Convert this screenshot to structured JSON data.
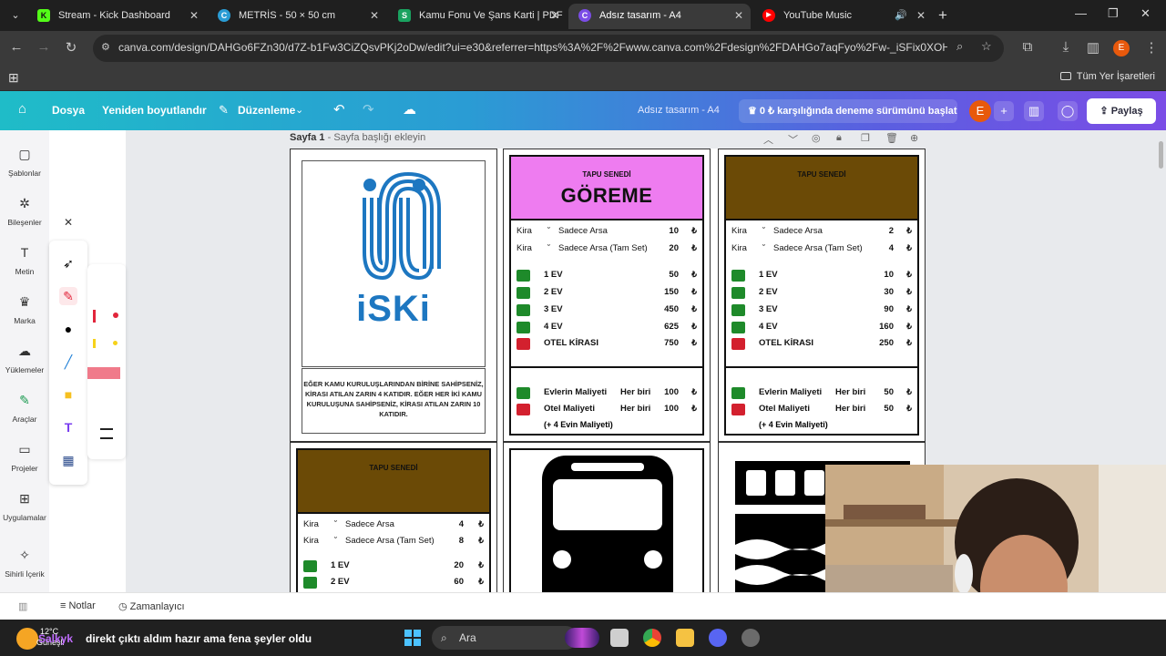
{
  "browser": {
    "tabs": [
      {
        "title": "Stream - Kick Dashboard",
        "icon": "kick-icon",
        "color": "#53fc18",
        "glyph": "K"
      },
      {
        "title": "METRİS - 50 × 50 cm",
        "icon": "canva-icon",
        "color": "#2a9cd4",
        "glyph": "C"
      },
      {
        "title": "Kamu Fonu Ve Şans Karti | PDF",
        "icon": "scribd-icon",
        "color": "#1aa260",
        "glyph": "S"
      },
      {
        "title": "Adsız tasarım - A4",
        "icon": "canva-icon",
        "color": "#7b4de6",
        "glyph": "C",
        "active": true
      },
      {
        "title": "YouTube Music",
        "icon": "youtube-music-icon",
        "color": "#ff0000",
        "glyph": "▶"
      }
    ],
    "url": "canva.com/design/DAHGo6FZn30/d7Z-b1Fw3CiZQsvPKj2oDw/edit?ui=e30&referrer=https%3A%2F%2Fwww.canva.com%2Fdesign%2FDAHGo7aqFyo%2Fw-_iSFix0XOHZaX8vt...",
    "profile_initial": "E",
    "bookmarks_all": "Tüm Yer İşaretleri"
  },
  "canva": {
    "home": "home-icon",
    "menu": [
      "Dosya",
      "Yeniden boyutlandır",
      "Düzenleme"
    ],
    "design_title": "Adsız tasarım - A4",
    "trial": "0 ₺ karşılığında deneme sürümünü başlat",
    "avatar": "E",
    "share": "Paylaş",
    "rail": [
      {
        "label": "Şablonlar",
        "icon": "templates-icon",
        "glyph": "▢"
      },
      {
        "label": "Bileşenler",
        "icon": "elements-icon",
        "glyph": "✲"
      },
      {
        "label": "Metin",
        "icon": "text-icon",
        "glyph": "T"
      },
      {
        "label": "Marka",
        "icon": "brand-icon",
        "glyph": "♛"
      },
      {
        "label": "Yüklemeler",
        "icon": "uploads-icon",
        "glyph": "☁"
      },
      {
        "label": "Araçlar",
        "icon": "draw-tools-icon",
        "glyph": "✎"
      },
      {
        "label": "Projeler",
        "icon": "folder-icon",
        "glyph": "▭"
      },
      {
        "label": "Uygulamalar",
        "icon": "apps-icon",
        "glyph": "⊞"
      },
      {
        "label": "Sihirli İçerik",
        "icon": "magic-media-icon",
        "glyph": "✧"
      }
    ],
    "page_label": "Sayfa 1",
    "page_title_placeholder": "Sayfa başlığı ekleyin",
    "notes": "Notlar",
    "timer": "Zamanlayıcı"
  },
  "cards": {
    "iski": {
      "logo_text": "iSKi",
      "note": "EĞER KAMU KURULUŞLARINDAN BİRİNE SAHİPSENİZ, KİRASI ATILAN ZARIN 4 KATIDIR. EĞER HER İKİ KAMU KURULUŞUNA SAHİPSENİZ, KİRASI ATILAN ZARIN 10 KATIDIR."
    },
    "goreme": {
      "header_label": "TAPU SENEDİ",
      "name": "GÖREME",
      "color": "#ee7cf0",
      "rent_label": "Kira",
      "land": "Sadece Arsa",
      "land_set": "Sadece Arsa (Tam Set)",
      "land_value": "10",
      "land_set_value": "20",
      "houses": [
        {
          "label": "1 EV",
          "value": "50"
        },
        {
          "label": "2 EV",
          "value": "150"
        },
        {
          "label": "3 EV",
          "value": "450"
        },
        {
          "label": "4 EV",
          "value": "625"
        }
      ],
      "hotel_label": "OTEL KİRASI",
      "hotel_value": "750",
      "house_cost_label": "Evlerin Maliyeti",
      "hotel_cost_label": "Otel Maliyeti",
      "each": "Her biri",
      "house_cost": "100",
      "hotel_cost": "100",
      "hotel_note": "(+ 4 Evin Maliyeti)",
      "currency": "₺"
    },
    "brown1": {
      "header_label": "TAPU SENEDİ",
      "color": "#6b4a06",
      "rent_label": "Kira",
      "land": "Sadece Arsa",
      "land_set": "Sadece Arsa (Tam Set)",
      "land_value": "2",
      "land_set_value": "4",
      "houses": [
        {
          "label": "1 EV",
          "value": "10"
        },
        {
          "label": "2 EV",
          "value": "30"
        },
        {
          "label": "3 EV",
          "value": "90"
        },
        {
          "label": "4 EV",
          "value": "160"
        }
      ],
      "hotel_label": "OTEL KİRASI",
      "hotel_value": "250",
      "house_cost_label": "Evlerin Maliyeti",
      "hotel_cost_label": "Otel Maliyeti",
      "each": "Her biri",
      "house_cost": "50",
      "hotel_cost": "50",
      "hotel_note": "(+ 4 Evin Maliyeti)",
      "currency": "₺"
    },
    "brown2": {
      "header_label": "TAPU SENEDİ",
      "color": "#6b4a06",
      "rent_label": "Kira",
      "land": "Sadece Arsa",
      "land_set": "Sadece Arsa (Tam Set)",
      "land_value": "4",
      "land_set_value": "8",
      "houses": [
        {
          "label": "1 EV",
          "value": "20"
        },
        {
          "label": "2 EV",
          "value": "60"
        }
      ],
      "currency": "₺"
    }
  },
  "taskbar": {
    "temp": "12°C",
    "weather": "Güneşli",
    "subtitle_user": "Salkyk",
    "subtitle": "direkt çıktı aldım hazır ama fena şeyler oldu",
    "search": "Ara"
  }
}
